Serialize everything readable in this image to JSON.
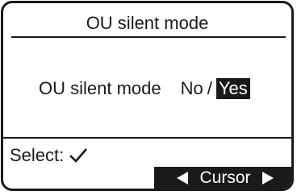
{
  "screen": {
    "title": "OU silent mode"
  },
  "setting": {
    "label": "OU silent mode",
    "options": [
      "No",
      "Yes"
    ],
    "separator": "/",
    "selected": "Yes"
  },
  "footer": {
    "select_label": "Select:",
    "select_icon": "checkmark-icon",
    "cursor_label": "Cursor",
    "cursor_left_icon": "left-triangle-icon",
    "cursor_right_icon": "right-triangle-icon"
  },
  "colors": {
    "foreground": "#1a1a1a",
    "background": "#ffffff"
  }
}
